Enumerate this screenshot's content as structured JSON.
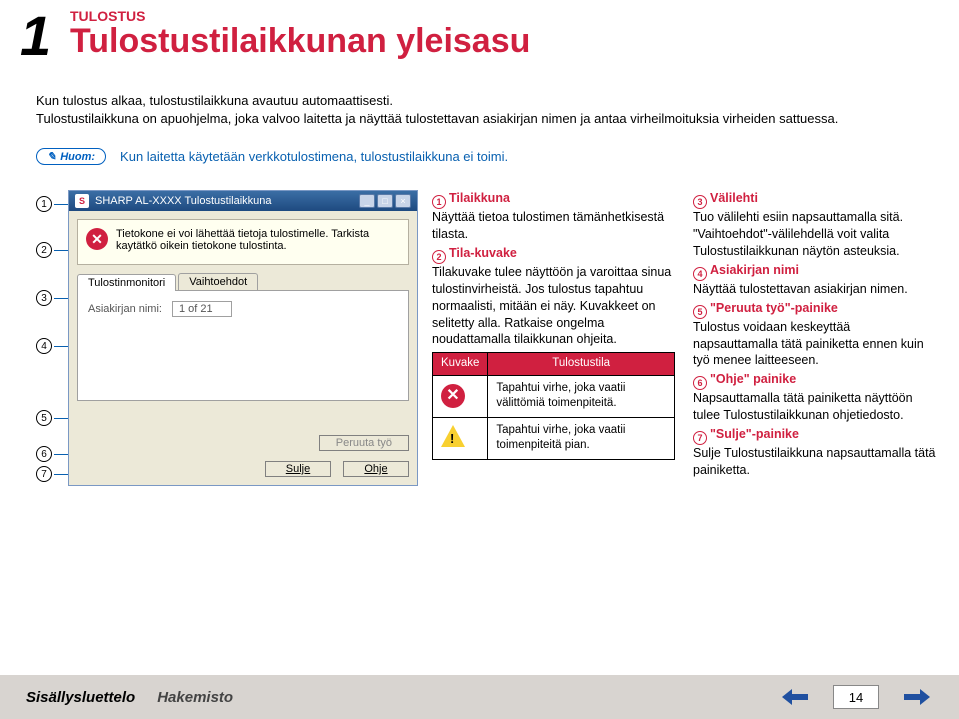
{
  "page_number_large": "1",
  "section_label": "TULOSTUS",
  "title": "Tulostustilaikkunan yleisasu",
  "intro_line1": "Kun tulostus alkaa, tulostustilaikkuna avautuu automaattisesti.",
  "intro_line2": "Tulostustilaikkuna on apuohjelma, joka valvoo laitetta ja näyttää tulostettavan asiakirjan nimen ja antaa virheilmoituksia virheiden sattuessa.",
  "note_badge": "Huom:",
  "note_text": "Kun laitetta käytetään verkkotulostimena, tulostustilaikkuna ei toimi.",
  "callouts": [
    "1",
    "2",
    "3",
    "4",
    "5",
    "6",
    "7"
  ],
  "mock": {
    "title_icon": "S",
    "title": "SHARP AL-XXXX Tulostustilaikkuna",
    "status_msg": "Tietokone ei voi lähettää tietoja tulostimelle. Tarkista kaytätkö oikein tietokone tulostinta.",
    "tabs": [
      "Tulostinmonitori",
      "Vaihtoehdot"
    ],
    "doc_label": "Asiakirjan nimi:",
    "doc_value": "1 of 21",
    "btn_cancel": "Peruuta työ",
    "btn_close": "Sulje",
    "btn_help": "Ohje"
  },
  "desc": {
    "i1_head": "Tilaikkuna",
    "i1_body": "Näyttää tietoa tulostimen tämänhetkisestä tilasta.",
    "i2_head": "Tila-kuvake",
    "i2_body": "Tilakuvake tulee näyttöön ja varoittaa sinua tulostinvirheistä. Jos tulostus tapahtuu normaalisti, mitään ei näy. Kuvakkeet on selitetty alla. Ratkaise ongelma noudattamalla tilaikkunan ohjeita.",
    "tbl_h1": "Kuvake",
    "tbl_h2": "Tulostustila",
    "tbl_r1": "Tapahtui virhe, joka vaatii välittömiä toimenpiteitä.",
    "tbl_r2": "Tapahtui virhe, joka vaatii toimenpiteitä pian.",
    "i3_head": "Välilehti",
    "i3_body": "Tuo välilehti esiin napsauttamalla sitä. \"Vaihtoehdot\"-välilehdellä voit valita Tulostustilaikkunan näytön asteuksia.",
    "i4_head": "Asiakirjan nimi",
    "i4_body": "Näyttää tulostettavan asiakirjan nimen.",
    "i5_head": "\"Peruuta työ\"-painike",
    "i5_body": "Tulostus voidaan keskeyttää napsauttamalla tätä painiketta ennen kuin työ menee laitteeseen.",
    "i6_head": "\"Ohje\" painike",
    "i6_body": "Napsauttamalla tätä painiketta näyttöön tulee Tulostustilaikkunan ohjetiedosto.",
    "i7_head": "\"Sulje\"-painike",
    "i7_body": "Sulje Tulostustilaikkuna napsauttamalla tätä painiketta."
  },
  "footer": {
    "toc": "Sisällysluettelo",
    "index": "Hakemisto",
    "page": "14"
  }
}
